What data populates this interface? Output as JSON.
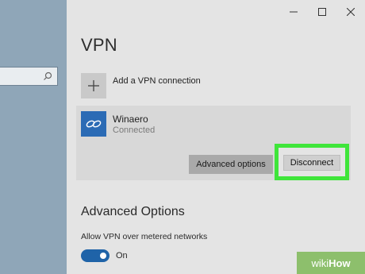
{
  "window": {
    "controls": [
      {
        "name": "minimize-button",
        "glyph": "—"
      },
      {
        "name": "maximize-button",
        "glyph": "☐"
      },
      {
        "name": "close-button",
        "glyph": "✕"
      }
    ]
  },
  "sidebar": {
    "search": {
      "value": "",
      "icon": "search-icon"
    }
  },
  "main": {
    "title": "VPN",
    "add_connection": {
      "label": "Add a VPN connection",
      "icon": "plus-icon"
    },
    "connection": {
      "name": "Winaero",
      "status": "Connected",
      "icon": "vpn-link-icon",
      "advanced_button": "Advanced options",
      "disconnect_button": "Disconnect"
    },
    "advanced": {
      "title": "Advanced Options",
      "metered_label": "Allow VPN over metered networks",
      "toggle_state": "On"
    }
  },
  "colors": {
    "accent": "#2b6bb5",
    "highlight": "#3fe53a",
    "toggle": "#1f63a8"
  },
  "watermark": {
    "brand_a": "wiki",
    "brand_b": "How"
  }
}
